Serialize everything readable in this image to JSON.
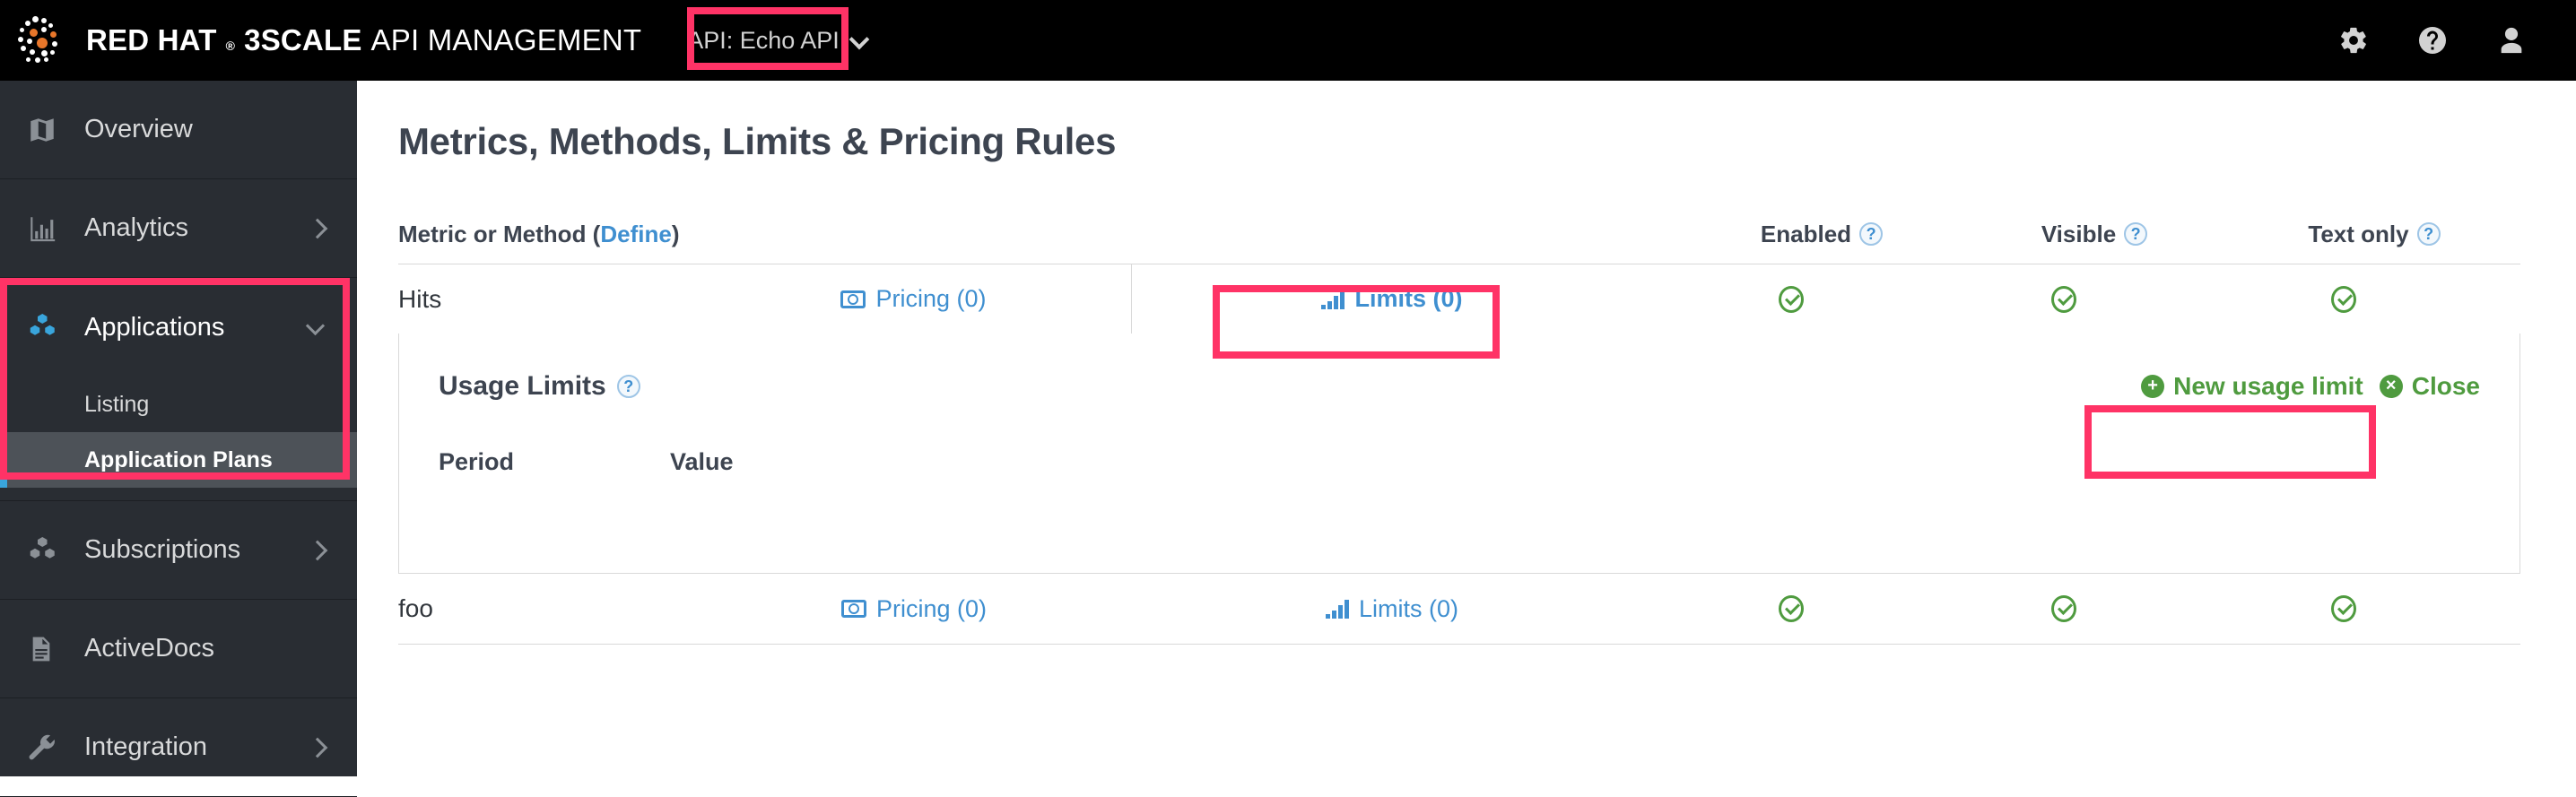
{
  "masthead": {
    "brand_red_hat": "RED HAT",
    "brand_reg": "®",
    "brand_3scale": "3SCALE",
    "brand_product": "API MANAGEMENT",
    "api_selector_label": "API: Echo API",
    "icons": {
      "settings": "gear-icon",
      "help": "help-circle-icon",
      "user": "user-icon"
    }
  },
  "sidebar": {
    "items": [
      {
        "label": "Overview",
        "icon": "map-icon",
        "expandable": false
      },
      {
        "label": "Analytics",
        "icon": "bar-chart-icon",
        "expandable": true
      },
      {
        "label": "Applications",
        "icon": "cubes-icon",
        "expandable": true,
        "expanded": true
      },
      {
        "label": "Subscriptions",
        "icon": "cubes-icon",
        "expandable": true
      },
      {
        "label": "ActiveDocs",
        "icon": "document-icon",
        "expandable": false
      },
      {
        "label": "Integration",
        "icon": "wrench-icon",
        "expandable": true
      }
    ],
    "applications_children": [
      {
        "label": "Listing",
        "selected": false
      },
      {
        "label": "Application Plans",
        "selected": true
      }
    ],
    "accent_color": "#39a5dc"
  },
  "main": {
    "page_title": "Metrics, Methods, Limits & Pricing Rules",
    "metric_header_prefix": "Metric or Method (",
    "metric_header_link": "Define",
    "metric_header_suffix": ")",
    "columns": [
      {
        "label": "Enabled",
        "help": "?"
      },
      {
        "label": "Visible",
        "help": "?"
      },
      {
        "label": "Text only",
        "help": "?"
      }
    ],
    "rows": [
      {
        "name": "Hits",
        "pricing_label": "Pricing (0)",
        "limits_label": "Limits (0)",
        "limits_active": true,
        "enabled": true,
        "visible": true,
        "text_only": true
      },
      {
        "name": "foo",
        "pricing_label": "Pricing (0)",
        "limits_label": "Limits (0)",
        "limits_active": false,
        "enabled": true,
        "visible": true,
        "text_only": true
      }
    ],
    "usage_limits_panel": {
      "title": "Usage Limits",
      "help": "?",
      "new_limit_label": "New usage limit",
      "new_limit_icon": "+",
      "close_label": "Close",
      "close_icon": "×",
      "col_period": "Period",
      "col_value": "Value",
      "rows": []
    }
  },
  "annotations": {
    "color": "#ff3366",
    "boxes": [
      {
        "name": "api-selector-highlight"
      },
      {
        "name": "applications-nav-highlight"
      },
      {
        "name": "limits-tab-highlight"
      },
      {
        "name": "new-usage-limit-highlight"
      }
    ]
  }
}
